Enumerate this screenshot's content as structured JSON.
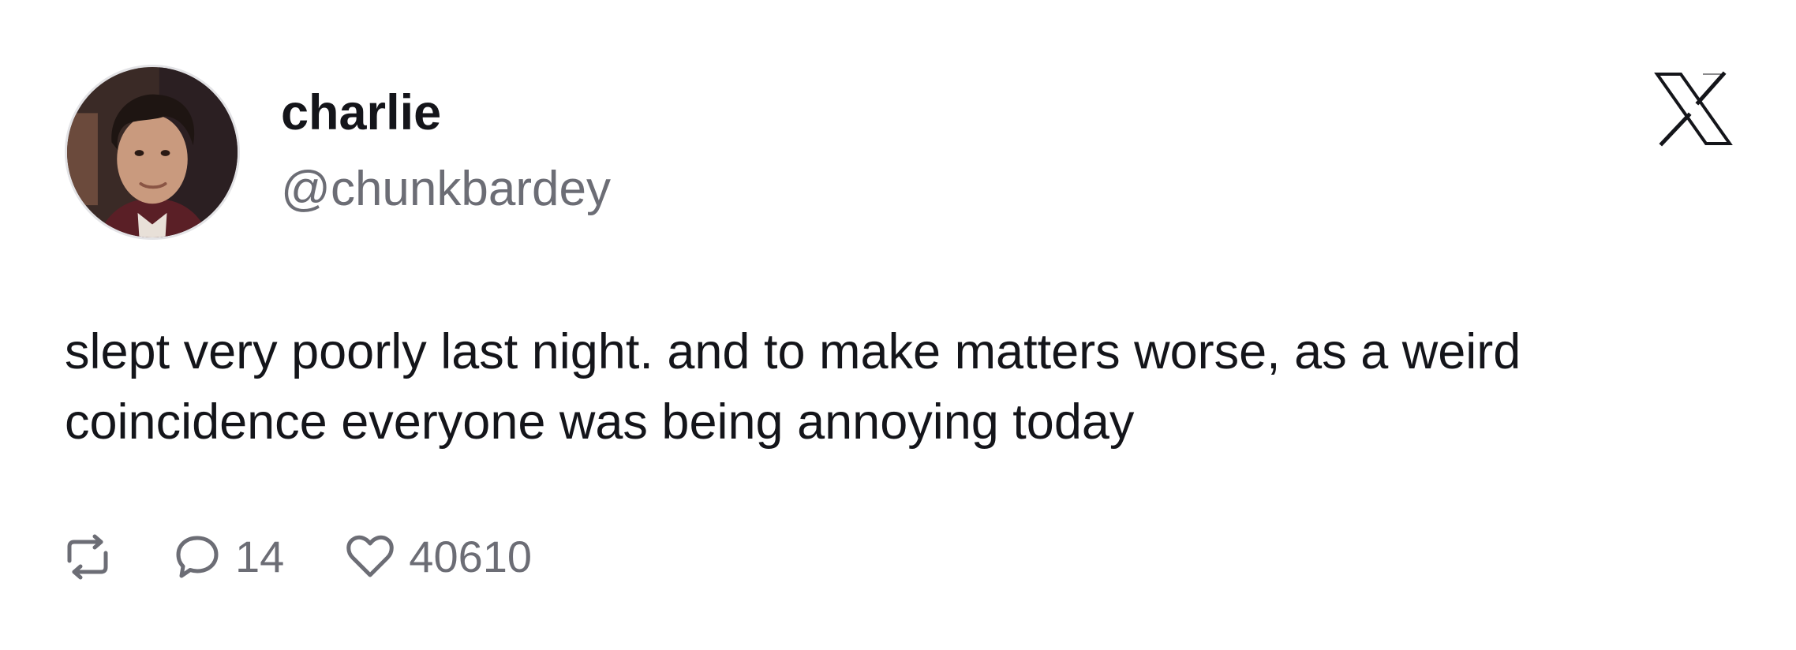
{
  "author": {
    "display_name": "charlie",
    "handle": "@chunkbardey",
    "avatar_icon": "profile-photo"
  },
  "brand": {
    "logo_icon": "x-logo-icon"
  },
  "post": {
    "text": "slept very poorly last night. and to make matters worse, as a weird coincidence everyone was being annoying today"
  },
  "actions": {
    "repost_icon": "repost-icon",
    "reply_icon": "reply-icon",
    "reply_count": "14",
    "like_icon": "heart-icon",
    "like_count": "40610"
  },
  "colors": {
    "text_primary": "#14151a",
    "text_secondary": "#6c6d75",
    "background": "#ffffff"
  }
}
